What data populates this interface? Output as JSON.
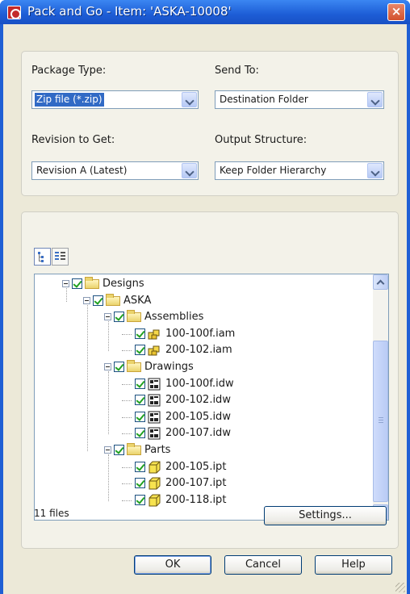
{
  "window": {
    "title": "Pack and Go - Item: 'ASKA-10008'",
    "close_glyph": "×"
  },
  "options": {
    "package_type": {
      "label": "Package Type:",
      "value": "Zip file (*.zip)"
    },
    "send_to": {
      "label": "Send To:",
      "value": "Destination Folder"
    },
    "revision": {
      "label": "Revision to Get:",
      "value": "Revision A (Latest)"
    },
    "output_structure": {
      "label": "Output Structure:",
      "value": "Keep Folder Hierarchy"
    }
  },
  "view_toggles": [
    {
      "icon": "tree-view-icon",
      "active": true
    },
    {
      "icon": "list-view-icon",
      "active": false
    }
  ],
  "tree": {
    "nodes": [
      {
        "name": "Designs",
        "kind": "folder",
        "level": 0,
        "expanded": true,
        "checked": true
      },
      {
        "name": "ASKA",
        "kind": "folder",
        "level": 1,
        "expanded": true,
        "checked": true
      },
      {
        "name": "Assemblies",
        "kind": "folder",
        "level": 2,
        "expanded": true,
        "checked": true
      },
      {
        "name": "100-100f.iam",
        "kind": "assembly",
        "level": 3,
        "checked": true
      },
      {
        "name": "200-102.iam",
        "kind": "assembly",
        "level": 3,
        "checked": true
      },
      {
        "name": "Drawings",
        "kind": "folder",
        "level": 2,
        "expanded": true,
        "checked": true
      },
      {
        "name": "100-100f.idw",
        "kind": "drawing",
        "level": 3,
        "checked": true
      },
      {
        "name": "200-102.idw",
        "kind": "drawing",
        "level": 3,
        "checked": true
      },
      {
        "name": "200-105.idw",
        "kind": "drawing",
        "level": 3,
        "checked": true
      },
      {
        "name": "200-107.idw",
        "kind": "drawing",
        "level": 3,
        "checked": true
      },
      {
        "name": "Parts",
        "kind": "folder",
        "level": 2,
        "expanded": true,
        "checked": true
      },
      {
        "name": "200-105.ipt",
        "kind": "part",
        "level": 3,
        "checked": true
      },
      {
        "name": "200-107.ipt",
        "kind": "part",
        "level": 3,
        "checked": true
      },
      {
        "name": "200-118.ipt",
        "kind": "part",
        "level": 3,
        "checked": true
      }
    ]
  },
  "summary": {
    "file_count": "11 files"
  },
  "buttons": {
    "settings": "Settings...",
    "ok": "OK",
    "cancel": "Cancel",
    "help": "Help"
  },
  "colors": {
    "title_bar": "#1d5dd6",
    "dialog_bg": "#ece9d8",
    "selection": "#316ac5",
    "check": "#21a121"
  }
}
